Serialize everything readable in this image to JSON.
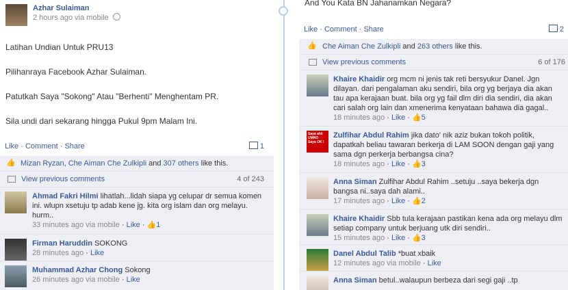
{
  "left": {
    "author": "Azhar Sulaiman",
    "meta": "2 hours ago via mobile",
    "lines": [
      "Latihan Undian Untuk PRU13",
      "Pilihanraya Facebook Azhar Sulaiman.",
      "Patutkah Saya \"Sokong\" Atau \"Berhenti\" Menghentam PR.",
      "Sila undi dari sekarang hingga Pukul 9pm Malam Ini."
    ],
    "actions": {
      "like": "Like",
      "comment": "Comment",
      "share": "Share",
      "comment_count": "1"
    },
    "likes": {
      "a": "Mizan Ryzan",
      "b": "Che Aiman Che Zulkipli",
      "c": "307 others",
      "suffix": "like this.",
      "and": "and"
    },
    "view_prev": "View previous comments",
    "pager": "4 of 243",
    "comments": [
      {
        "name": "Ahmad Fakri Hilmi",
        "text": "lihatlah...lidah siapa yg celupar dr semua komen ini. wlupn xsetuju tp adab kene jg. kita org islam dan org melayu. hurm..",
        "time": "33 minutes ago via mobile",
        "likes": "1"
      },
      {
        "name": "Firman Haruddin",
        "text": "SOKONG",
        "time": "28 minutes ago",
        "likes": ""
      },
      {
        "name": "Muhammad Azhar Chong",
        "text": "Sokong",
        "time": "26 minutes ago via mobile",
        "likes": ""
      }
    ]
  },
  "right": {
    "top_text": "And You Kata BN Jahanamkan Negara?",
    "actions": {
      "like": "Like",
      "comment": "Comment",
      "share": "Share",
      "comment_count": "2"
    },
    "likes": {
      "a": "Che Aiman Che Zulkipli",
      "and": "and",
      "c": "263 others",
      "suffix": "like this."
    },
    "view_prev": "View previous comments",
    "pager": "6 of 176",
    "comments": [
      {
        "name": "Khaire Khaidir",
        "text": "org mcm ni jenis tak reti bersyukur Danel. Jgn dilayan. dari pengalaman aku sendiri, bila org yg berjaya dia akan tau apa kerajaan buat. bila org yg fail dlm diri dia sendiri, dia akan cari salah org lain dan xmenerima kenyataan bahawa dia gagal..",
        "time": "18 minutes ago",
        "likes": "5"
      },
      {
        "name": "Zulfihar Abdul Rahim",
        "text": "jika dato' nik aziz bukan tokoh politik, dapatkah beliau tawaran berkerja di LAM SOON dengan gaji yang sama dgn perkerja berbangsa cina?",
        "time": "18 minutes ago",
        "likes": "3",
        "av_text": "Saya ahli UMNO Saya OK !"
      },
      {
        "name": "Anna Siman",
        "text": "Zulfihar Abdul Rahim ..setuju ..saya bekerja dgn bangsa ni..saya dah alami..",
        "time": "17 minutes ago",
        "likes": "2"
      },
      {
        "name": "Khaire Khaidir",
        "text": "Sbb tula kerajaan pastikan kena ada org melayu dlm setiap company untuk berjuang utk diri sendiri..",
        "time": "15 minutes ago",
        "likes": "3"
      },
      {
        "name": "Danel Abdul Talib",
        "text": "*buat xbaik",
        "time": "12 minutes ago via mobile",
        "likes": ""
      },
      {
        "name": "Anna Siman",
        "text": "betul..walaupun berbeza dari segi gaji ..tp",
        "time": "",
        "likes": ""
      }
    ]
  },
  "ui": {
    "like": "Like"
  },
  "colors": {
    "link": "#3b5998",
    "box": "#edeff4"
  }
}
